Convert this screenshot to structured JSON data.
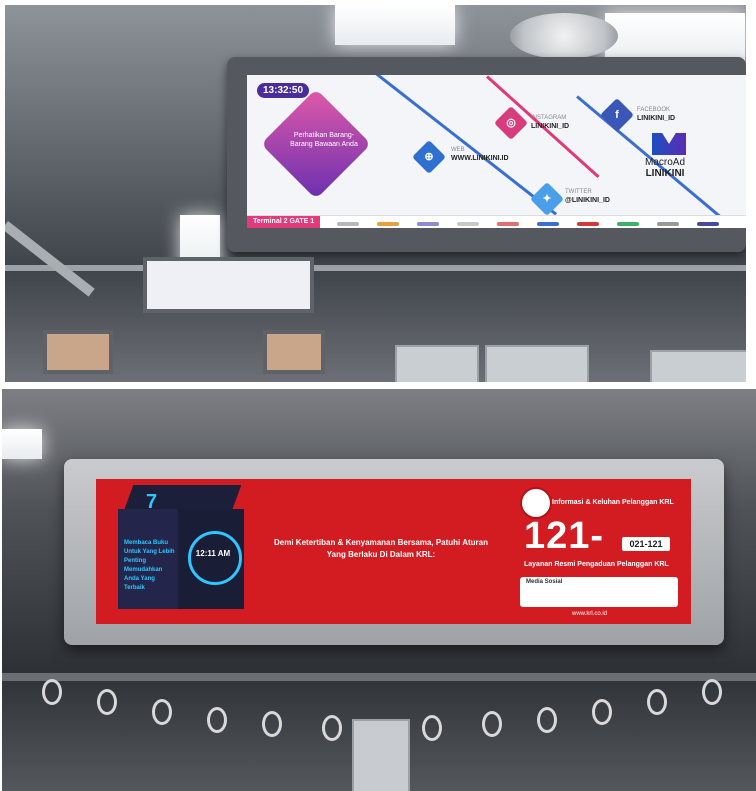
{
  "top_screen": {
    "clock": "13:32:50",
    "card_text": "Perhatikan Barang-Barang Bawaan Anda",
    "instagram_label": "INSTAGRAM",
    "instagram_value": "LINIKINI_ID",
    "facebook_label": "FACEBOOK",
    "facebook_value": "LINIKINI_ID",
    "web_label": "WEB",
    "web_value": "WWW.LINIKINI.ID",
    "twitter_label": "TWITTER",
    "twitter_value": "@LINIKINI_ID",
    "brand_name_1": "MacroAd",
    "brand_name_2": "LINIKINI",
    "terminal_tag": "Terminal 2  GATE 1"
  },
  "bottom_screen": {
    "cube_digit": "7",
    "cube_text": "Membaca Buku Untuk Yang Lebih Penting Memudahkan Anda Yang Terbaik",
    "cube_clock": "12:11 AM",
    "message": "Demi Ketertiban & Kenyamanan Bersama, Patuhi Aturan Yang Berlaku Di Dalam KRL:",
    "panel_header": "Informasi & Keluhan Pelanggan KRL",
    "hotline": "121-",
    "phone_box": "021-121",
    "layanan": "Layanan Resmi Pengaduan Pelanggan KRL",
    "social_title": "Media Sosial",
    "url": "www.krl.co.id"
  },
  "colors": {
    "red_screen": "#d21c22",
    "accent_blue": "#3a6fd1",
    "accent_pink": "#e0387a"
  }
}
